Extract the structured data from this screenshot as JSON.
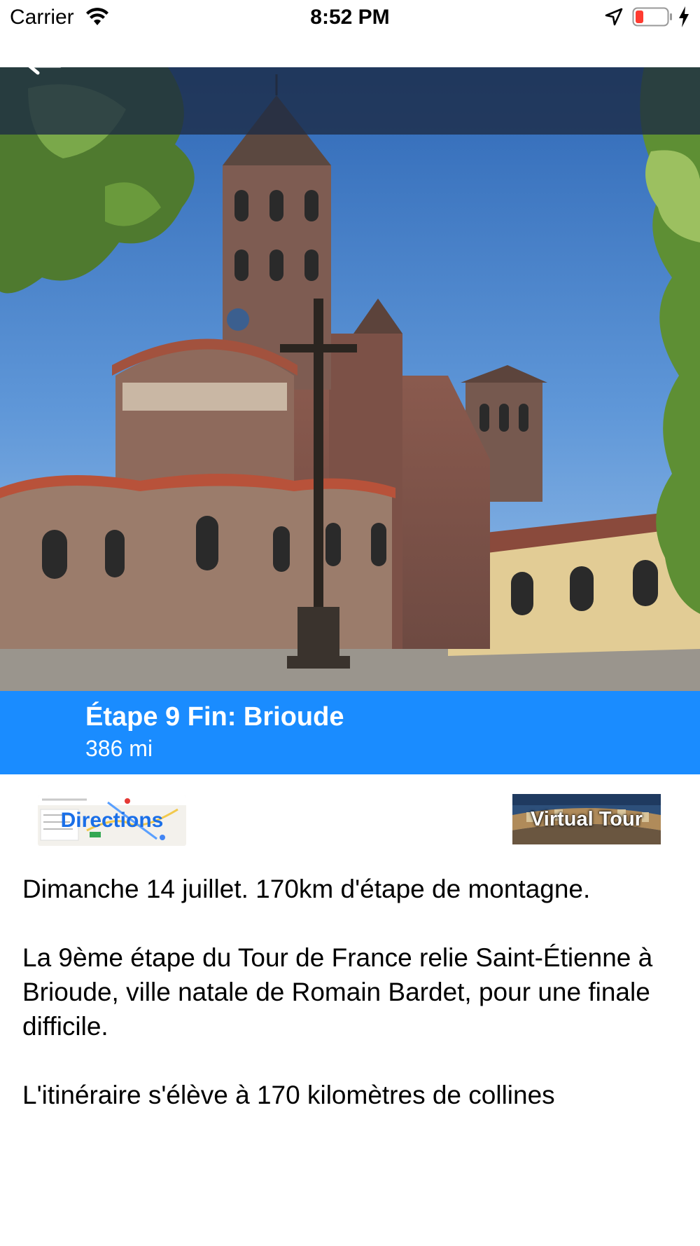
{
  "status_bar": {
    "carrier": "Carrier",
    "time": "8:52 PM",
    "battery_color": "#ff3b30"
  },
  "hero": {
    "image": "basilica-saint-julien-brioude",
    "back_icon": "back-arrow-icon"
  },
  "stage": {
    "title": "Étape 9 Fin: Brioude",
    "distance": "386 mi",
    "accent_color": "#1a8cff"
  },
  "actions": {
    "directions_label": "Directions",
    "virtual_tour_label": "Virtual Tour"
  },
  "description": {
    "p1": "Dimanche 14 juillet. 170km d'étape de montagne.",
    "p2": "La 9ème étape du Tour de France relie Saint-Étienne à Brioude, ville natale de Romain Bardet, pour une finale difficile.",
    "p3": "L'itinéraire s'élève à 170 kilomètres de collines"
  }
}
